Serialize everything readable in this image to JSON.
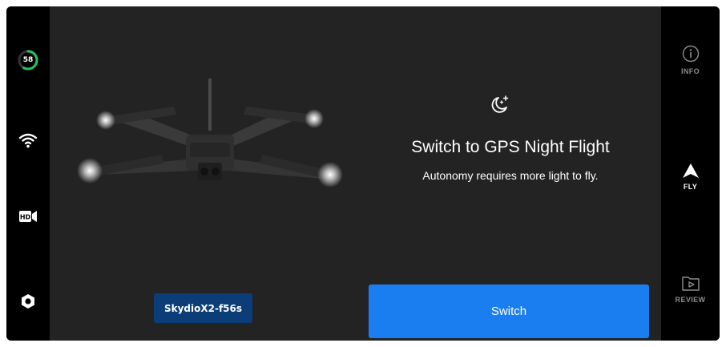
{
  "status": {
    "battery_percent": "58",
    "battery_fraction": 0.58,
    "battery_color": "#22c55e"
  },
  "left_rail_icons": [
    "wifi-icon",
    "hd-video-icon",
    "settings-icon"
  ],
  "nav": {
    "info_label": "INFO",
    "fly_label": "FLY",
    "review_label": "REVIEW"
  },
  "prompt": {
    "icon": "moon-stars-icon",
    "title": "Switch to GPS Night Flight",
    "subtitle": "Autonomy requires more light to fly."
  },
  "drone": {
    "name": "SkydioX2-f56s"
  },
  "actions": {
    "switch_label": "Switch",
    "accent_color": "#1b7ef0"
  }
}
